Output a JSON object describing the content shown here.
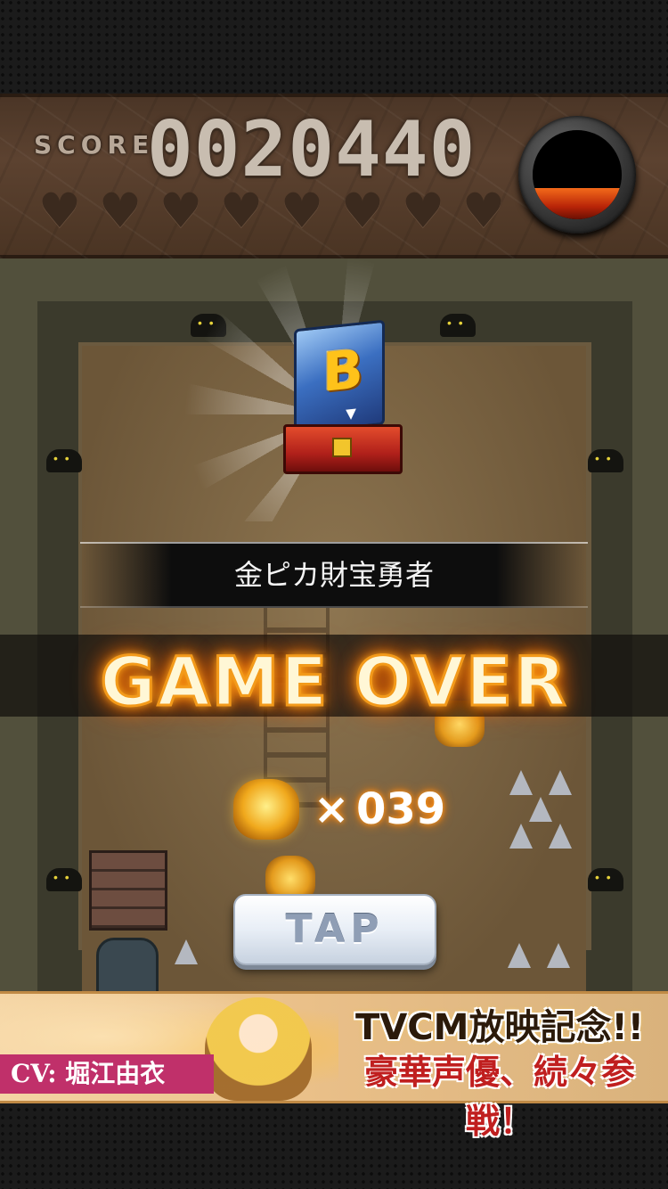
{
  "hud": {
    "score_label": "SCORE",
    "score_value": "0020440",
    "hearts_total": 8,
    "hearts_filled": 0,
    "gauge_level": 0.35,
    "gauge_color": "#d4360c"
  },
  "result": {
    "rank": "B",
    "title": "金ピカ財宝勇者",
    "status": "GAME OVER",
    "coin_multiplier": "×",
    "coin_count": "039",
    "tap_label": "TAP"
  },
  "banner": {
    "headline": "TVCM放映記念!!",
    "subline": "豪華声優、続々参戦！",
    "cv_credit": "CV: 堀江由衣"
  },
  "colors": {
    "gameover_glow": "#ff7a00",
    "banner_cv_bg": "#c0306a"
  }
}
